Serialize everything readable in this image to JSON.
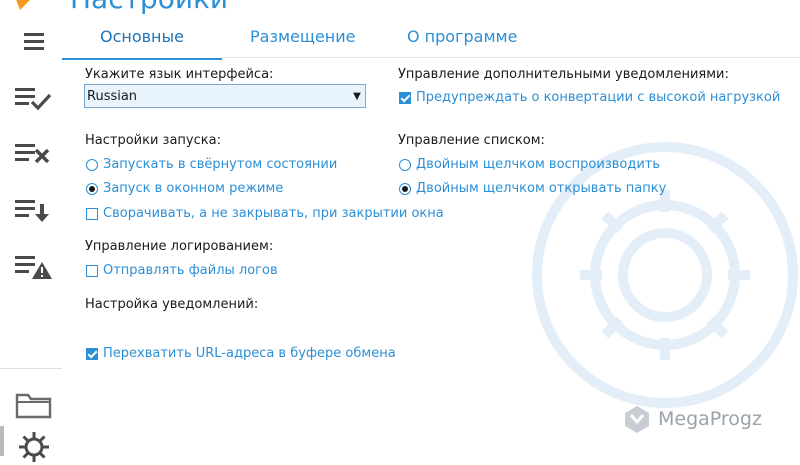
{
  "app": {
    "title": "Настройки",
    "brand": "MegaProgz"
  },
  "sidebar": {
    "items": [
      {
        "icon": "menu-icon"
      },
      {
        "icon": "list-check-icon"
      },
      {
        "icon": "list-remove-icon"
      },
      {
        "icon": "list-download-icon"
      },
      {
        "icon": "list-warning-icon"
      },
      {
        "icon": "folder-icon"
      },
      {
        "icon": "gear-icon"
      }
    ]
  },
  "tabs": [
    {
      "label": "Основные",
      "active": true
    },
    {
      "label": "Размещение",
      "active": false
    },
    {
      "label": "О программе",
      "active": false
    }
  ],
  "language": {
    "label": "Укажите язык интерфейса:",
    "selected": "Russian"
  },
  "startup": {
    "label": "Настройки запуска:",
    "option_minimized": "Запускать в свёрнутом состоянии",
    "option_window": "Запуск в оконном режиме",
    "selected": "window",
    "minimize_on_close_label": "Сворачивать, а не закрывать, при закрытии окна",
    "minimize_on_close_checked": false
  },
  "logging": {
    "label": "Управление логированием:",
    "send_logs_label": "Отправлять файлы логов",
    "send_logs_checked": false
  },
  "notifications": {
    "label": "Настройка уведомлений:"
  },
  "clipboard": {
    "label": "Перехватить URL-адреса в буфере обмена",
    "checked": true
  },
  "extra_notifications": {
    "label": "Управление дополнительными уведомлениями:",
    "warn_label": "Предупреждать о конвертации с высокой нагрузкой",
    "warn_checked": true
  },
  "list_control": {
    "label": "Управление списком:",
    "option_play": "Двойным щелчком воспроизводить",
    "option_open_folder": "Двойным щелчком открывать папку",
    "selected": "open_folder"
  },
  "colors": {
    "accent": "#2b8fd6",
    "icon": "#4a4a4a",
    "brand_gray": "#9aa3ab",
    "logo_orange": "#f39a1e"
  }
}
